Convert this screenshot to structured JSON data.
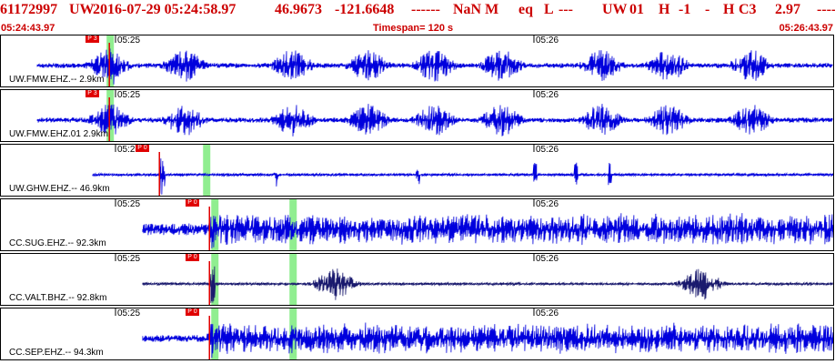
{
  "header": {
    "event_id": "61172997",
    "network": "UW",
    "datetime": "2016-07-29 05:24:58.97",
    "latitude": "46.9673",
    "longitude": "-121.6648",
    "dashes1": "------",
    "magnitude": "NaN M",
    "type": "eq",
    "l": "L",
    "dashes2": "---",
    "src": "UW",
    "version": "01",
    "h1": "H",
    "neg": "-1",
    "dash": "-",
    "h2": "H",
    "c": "C3",
    "depth": "2.97",
    "dashes3": "-----"
  },
  "subheader": {
    "start": "05:24:43.97",
    "timespan": "Timespan= 120 s",
    "end": "05:26:43.97"
  },
  "colors": {
    "header_text": "#cc0000",
    "trace_blue": "#0000dd",
    "trace_navy": "#1a1a6e",
    "pick_red": "#e00000",
    "marker_green": "#90ee90"
  },
  "time_ticks": [
    "05:25",
    "05:26"
  ],
  "panels": [
    {
      "label": "UW.FMW.EHZ.--  2.9km",
      "pick": "P 3",
      "trace_color": "blue",
      "start_frac": 0.0,
      "onset_frac": 0.13,
      "noise": 0.22,
      "style": "bursts",
      "burst_times": [
        0.13,
        0.22,
        0.35,
        0.44,
        0.52,
        0.6,
        0.72,
        0.8,
        0.9
      ]
    },
    {
      "label": "UW.FMW.EHZ.01  2.9km",
      "pick": "P 3",
      "trace_color": "blue",
      "start_frac": 0.0,
      "onset_frac": 0.13,
      "noise": 0.22,
      "style": "bursts",
      "burst_times": [
        0.13,
        0.22,
        0.35,
        0.44,
        0.52,
        0.6,
        0.72,
        0.8,
        0.9
      ]
    },
    {
      "label": "UW.GHW.EHZ.-- 46.9km",
      "pick": "P 0",
      "trace_color": "blue",
      "start_frac": 0.11,
      "onset_frac": 0.19,
      "noise": 0.05,
      "style": "spikes",
      "burst_times": [
        0.33,
        0.5,
        0.64,
        0.69,
        0.73
      ]
    },
    {
      "label": "CC.SUG.EHZ.-- 92.3km",
      "pick": "P 0",
      "trace_color": "blue",
      "start_frac": 0.17,
      "onset_frac": 0.25,
      "noise": 0.7,
      "style": "noisy",
      "burst_times": [
        0.27,
        0.35
      ]
    },
    {
      "label": "CC.VALT.BHZ.-- 92.8km",
      "pick": "P 0",
      "trace_color": "navy",
      "start_frac": 0.17,
      "onset_frac": 0.25,
      "noise": 0.05,
      "style": "bursts",
      "burst_times": [
        0.4,
        0.84
      ]
    },
    {
      "label": "CC.SEP.EHZ.-- 94.3km",
      "pick": "P 0",
      "trace_color": "blue",
      "start_frac": 0.17,
      "onset_frac": 0.25,
      "noise": 0.35,
      "style": "noisy",
      "burst_times": [
        0.27
      ]
    }
  ]
}
